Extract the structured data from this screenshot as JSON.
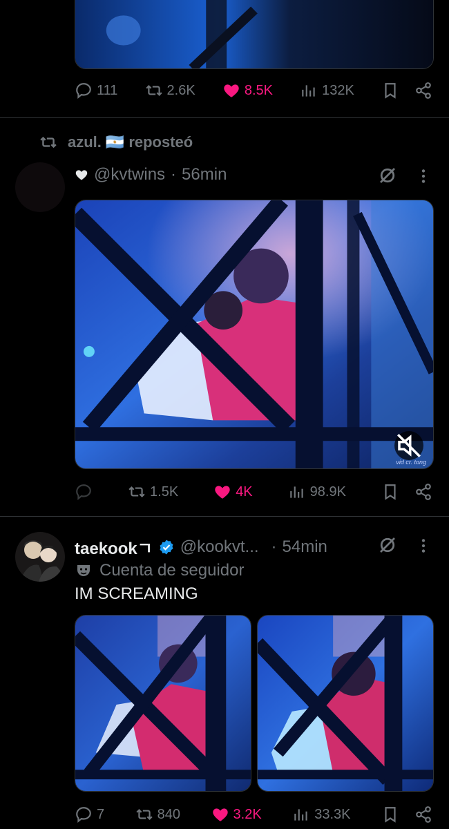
{
  "post1": {
    "stats": {
      "replies": "111",
      "reposts": "2.6K",
      "likes": "8.5K",
      "views": "132K"
    }
  },
  "post2": {
    "repost_header": {
      "user": "azul.",
      "flag": "🇦🇷",
      "action": "reposteó"
    },
    "handle": "@kvtwins",
    "time": "56min",
    "video_watermark": "vid cr. tong",
    "stats": {
      "reposts": "1.5K",
      "likes": "4K",
      "views": "98.9K"
    }
  },
  "post3": {
    "name": "taekook",
    "name_glyph": "ㄱ",
    "handle": "@kookvt...",
    "time": "54min",
    "label": "Cuenta de seguidor",
    "text": "IM SCREAMING",
    "stats": {
      "replies": "7",
      "reposts": "840",
      "likes": "3.2K",
      "views": "33.3K"
    }
  },
  "colors": {
    "background": "#000000",
    "muted": "#71767b",
    "like": "#f91880",
    "verified": "#1d9bf0",
    "divider": "#2f3336"
  }
}
